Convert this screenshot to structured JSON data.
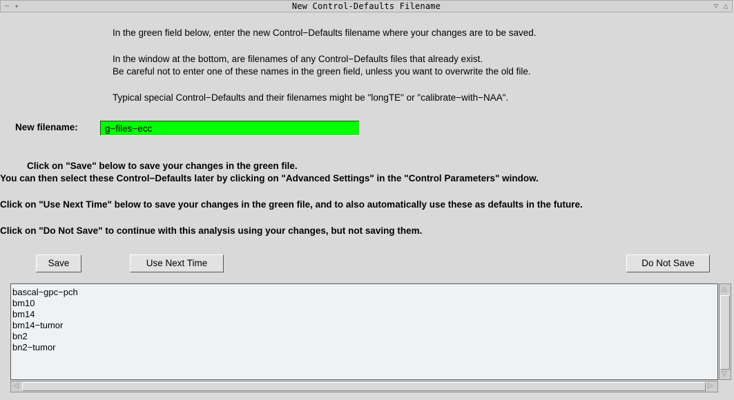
{
  "window": {
    "title": "New Control-Defaults Filename",
    "left_buttons": "−✦",
    "right_buttons": "▽△"
  },
  "intro": {
    "line1": "In the green field below, enter the new Control−Defaults filename where your changes are to be saved.",
    "line2": "In the window at the bottom, are filenames of any Control−Defaults files that already exist.",
    "line3": "Be careful not to enter one of these names in the green field, unless you want to overwrite the old file.",
    "line4": "Typical special Control−Defaults and their filenames might be \"longTE\" or \"calibrate−with−NAA\"."
  },
  "filename": {
    "label": "New filename:",
    "value": "g−files−ecc"
  },
  "instructions": {
    "save_line": "Click on \"Save\" below to save your changes in the green file.",
    "select_line": "You can then select these Control−Defaults later by clicking on \"Advanced Settings\" in the \"Control Parameters\" window.",
    "use_next_line": "Click on \"Use Next Time\" below to save your changes in the green file, and to also automatically use these as defaults in the future.",
    "do_not_save_line": "Click on \"Do Not Save\" to continue with this analysis using your changes, but not saving them."
  },
  "buttons": {
    "save": "Save",
    "use_next_time": "Use Next Time",
    "do_not_save": "Do Not Save"
  },
  "existing_files": [
    "bascal−gpc−pch",
    "bm10",
    "bm14",
    "bm14−tumor",
    "bn2",
    "bn2−tumor"
  ],
  "colors": {
    "input_background": "#00ff00",
    "window_background": "#d9d9d9",
    "list_background": "#eff2f5"
  }
}
